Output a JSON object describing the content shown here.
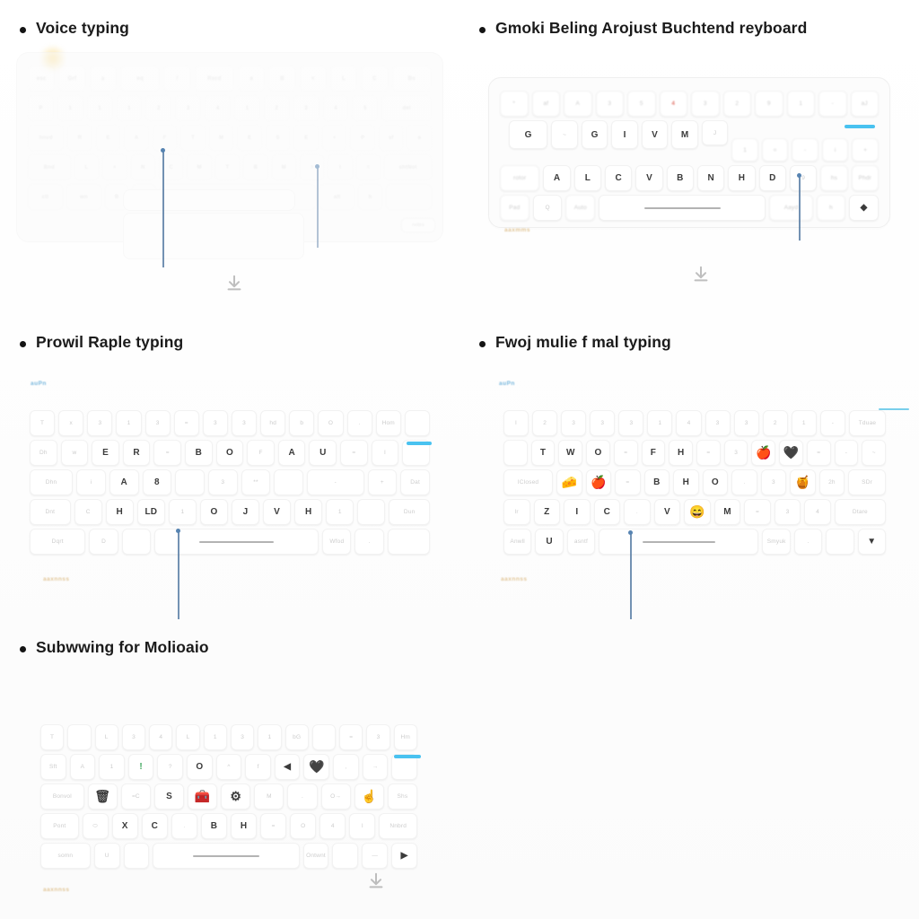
{
  "page": {
    "background_color": "#ffffff",
    "accent_color": "#49c2f0",
    "pointer_color": "#5b7fa6",
    "heading_color": "#1b1b1b"
  },
  "panels": [
    {
      "id": "voice-typing",
      "heading": "Voice typing",
      "icons": {
        "download": "download-arrow-icon"
      },
      "keyboard": {
        "style": "washed",
        "rows": [
          [
            "esc",
            "Grf",
            "a",
            "eq",
            "/",
            "Rscd",
            "a",
            "B",
            "<",
            "L",
            "C",
            "Bs"
          ],
          [
            "P",
            "1",
            "1",
            "1",
            "2",
            "3",
            "4",
            "1",
            "2",
            "3",
            "4",
            "5",
            "del"
          ],
          [
            "hnvd",
            "R",
            "E",
            "A",
            "F",
            "T",
            "M",
            "E",
            "S",
            "E",
            "+",
            "P",
            "sf",
            "a"
          ],
          [
            "Bnd",
            "L",
            "+",
            "N",
            "C",
            "M",
            "T",
            "B",
            "M",
            "=",
            "t",
            "=",
            "shtNot"
          ],
          [
            "ctl",
            "wn",
            "B",
            "Pof",
            "",
            "Spc",
            "",
            "alt",
            "",
            "h",
            ""
          ]
        ]
      }
    },
    {
      "id": "gmoki-keyboard",
      "heading": "Gmoki Beling Arojust Buchtend reyboard",
      "icons": {
        "download": "download-arrow-icon"
      },
      "keyboard": {
        "style": "normal",
        "rows": [
          [
            "*",
            "af",
            "A",
            "3",
            "5",
            "4",
            "3",
            "2",
            "9",
            "1",
            "-",
            "aJ"
          ],
          [
            "G",
            "~",
            "G",
            "I",
            "V",
            "M",
            "J",
            "",
            "1",
            "=",
            "-",
            "i",
            "+"
          ],
          [
            "rotor",
            "A",
            "L",
            "C",
            "V",
            "B",
            "N",
            "H",
            "D",
            "9",
            "*",
            "hs",
            "Phdr"
          ],
          [
            "Pad",
            "Q",
            "Auto",
            "",
            "Spc",
            "",
            "Aayd",
            "",
            "h",
            ""
          ]
        ]
      }
    },
    {
      "id": "prowil-raple-typing",
      "heading": "Prowil Raple typing",
      "keyboard": {
        "style": "normal",
        "rows": [
          [
            "T",
            "x",
            "3",
            "1",
            "3",
            "=",
            "3",
            "3",
            "hd",
            "b",
            "O",
            ".",
            "Hom",
            ""
          ],
          [
            "Dh",
            "w",
            "E",
            "R",
            "=",
            "B",
            "O",
            "F",
            "A",
            "U",
            "=",
            "I",
            ""
          ],
          [
            "Dhn",
            "i",
            "A",
            "8",
            "",
            "3",
            "**",
            "",
            "-",
            "",
            "+",
            "Dat"
          ],
          [
            "Dnt",
            "C",
            "H",
            "LD",
            "1",
            "O",
            "J",
            "V",
            "H",
            "1",
            "",
            "Dun"
          ],
          [
            "Dqrt",
            "",
            "D",
            "",
            "",
            "Spc",
            "",
            "",
            "Wfod",
            ".",
            ""
          ]
        ]
      }
    },
    {
      "id": "fwoj-mulief-mal-typing",
      "heading": "Fwoj mulie f mal typing",
      "keyboard": {
        "style": "normal",
        "rows": [
          [
            "I",
            "2",
            "3",
            "3",
            "3",
            "1",
            "4",
            "3",
            "3",
            "2",
            "1",
            "-",
            "Tduae"
          ],
          [
            "T",
            "W",
            "O",
            "=",
            "F",
            "H",
            "=",
            "3",
            "🍎",
            "🖤",
            "=",
            "-",
            "~"
          ],
          [
            "IClosed",
            "🧀",
            "🍎",
            "=",
            "B",
            "H",
            "O",
            ".",
            "3",
            "🍯",
            "2h",
            "SDr"
          ],
          [
            "lr",
            "Z",
            "I",
            "C",
            ".",
            "V",
            "😄",
            "M",
            "=",
            "3",
            "4",
            "Dtare"
          ],
          [
            "Anwll",
            "U",
            "asntf",
            "",
            "Spc",
            "",
            "Smyuk",
            ".",
            "",
            "▼"
          ]
        ]
      }
    },
    {
      "id": "subwwing-for-molioaio",
      "heading": "Subwwing for Molioaio",
      "icons": {
        "download": "download-arrow-icon"
      },
      "keyboard": {
        "style": "normal",
        "rows": [
          [
            "T",
            "",
            "L",
            "3",
            "4",
            "L",
            "1",
            "3",
            "1",
            "bG",
            "",
            "=",
            "3",
            "Hm"
          ],
          [
            "Sft",
            "A",
            "1",
            "!",
            "?",
            "O",
            "^",
            "f",
            "◀",
            "🖤",
            ",",
            "→",
            ""
          ],
          [
            "Bonvol",
            "🗑",
            "=C",
            "S",
            "🧰",
            "⚙",
            "M",
            ".",
            "O→",
            "☝",
            "Shs"
          ],
          [
            "Pont",
            "⬭",
            "X",
            "C",
            ".",
            "B",
            "H",
            "=",
            "O",
            "4",
            "I",
            "Nnbrd"
          ],
          [
            "somn",
            "",
            "U",
            "",
            "",
            "Spc",
            "",
            "Ontwnt",
            "",
            "—",
            "▶"
          ]
        ]
      }
    }
  ]
}
